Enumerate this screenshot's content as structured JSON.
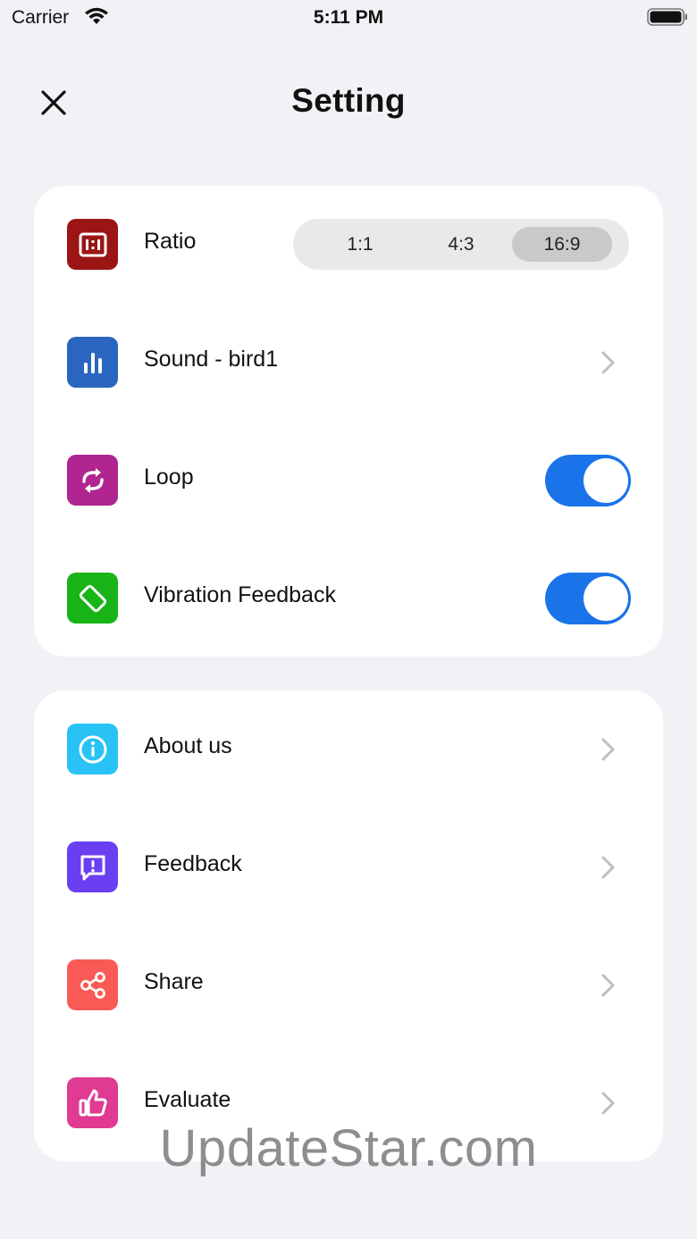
{
  "status_bar": {
    "carrier": "Carrier",
    "time": "5:11 PM"
  },
  "nav": {
    "title": "Setting"
  },
  "settings": {
    "ratio": {
      "label": "Ratio",
      "options": [
        "1:1",
        "4:3",
        "16:9"
      ],
      "selected": "16:9"
    },
    "sound": {
      "label": "Sound - bird1"
    },
    "loop": {
      "label": "Loop",
      "enabled": true
    },
    "vibration": {
      "label": "Vibration Feedback",
      "enabled": true
    }
  },
  "more": {
    "about": {
      "label": "About us"
    },
    "feedback": {
      "label": "Feedback"
    },
    "share": {
      "label": "Share"
    },
    "evaluate": {
      "label": "Evaluate"
    }
  },
  "watermark": "UpdateStar.com",
  "colors": {
    "ratio_icon": "#9b1515",
    "sound_icon": "#2a66c0",
    "loop_icon": "#b0258f",
    "vibration_icon": "#18b418",
    "about_icon": "#29c2f5",
    "feedback_icon": "#6a3ff2",
    "share_icon": "#f95a56",
    "evaluate_icon": "#e03a93",
    "toggle_on": "#1a73e8"
  }
}
